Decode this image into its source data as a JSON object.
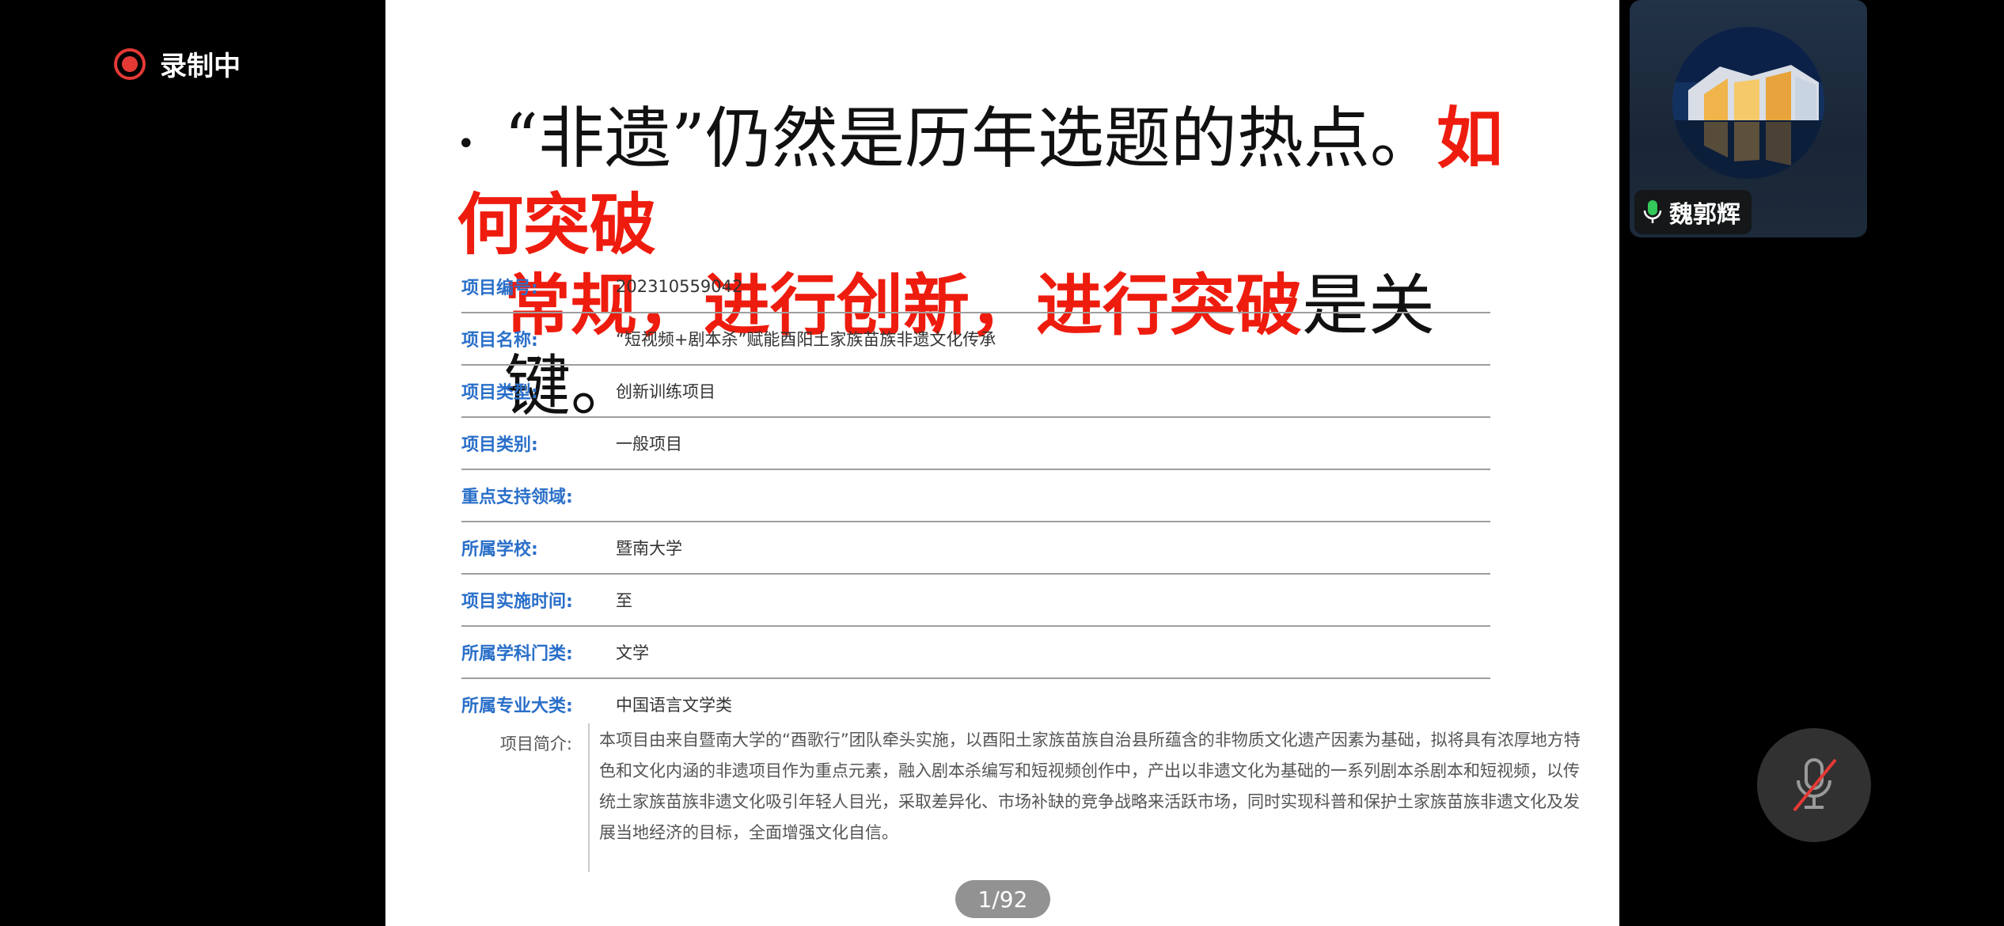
{
  "recording": {
    "label": "录制中"
  },
  "slide": {
    "headline": {
      "bullet": "•",
      "black_1": "“非遗”仍然是历年选题的热点。",
      "red_1": "如何突破",
      "red_2": "常规，进行创新，进行突破",
      "black_2": "是关键。"
    },
    "fields": [
      {
        "key": "项目编号:",
        "value": "202310559042"
      },
      {
        "key": "项目名称:",
        "value": "“短视频+剧本杀”赋能酉阳土家族苗族非遗文化传承"
      },
      {
        "key": "项目类型:",
        "value": "创新训练项目"
      },
      {
        "key": "项目类别:",
        "value": "一般项目"
      },
      {
        "key": "重点支持领域:",
        "value": ""
      },
      {
        "key": "所属学校:",
        "value": "暨南大学"
      },
      {
        "key": "项目实施时间:",
        "value": "至"
      },
      {
        "key": "所属学科门类:",
        "value": "文学"
      },
      {
        "key": "所属专业大类:",
        "value": "中国语言文学类"
      }
    ],
    "intro": {
      "key": "项目简介:",
      "value": "本项目由来自暨南大学的“酉歌行”团队牵头实施，以酉阳土家族苗族自治县所蕴含的非物质文化遗产因素为基础，拟将具有浓厚地方特色和文化内涵的非遗项目作为重点元素，融入剧本杀编写和短视频创作中，产出以非遗文化为基础的一系列剧本杀剧本和短视频，以传统土家族苗族非遗文化吸引年轻人目光，采取差异化、市场补缺的竞争战略来活跃市场，同时实现科普和保护土家族苗族非遗文化及发展当地经济的目标，全面增强文化自信。"
    }
  },
  "pager": {
    "text": "1/92"
  },
  "participant": {
    "name": "魏郭辉",
    "mic_icon": "mic-active-icon"
  },
  "controls": {
    "mute_icon": "mic-muted-icon"
  },
  "colors": {
    "headline_red": "#ee1c0e",
    "field_key_blue": "#2a6fc9",
    "rec_red": "#e53935",
    "mic_green": "#34c759"
  }
}
